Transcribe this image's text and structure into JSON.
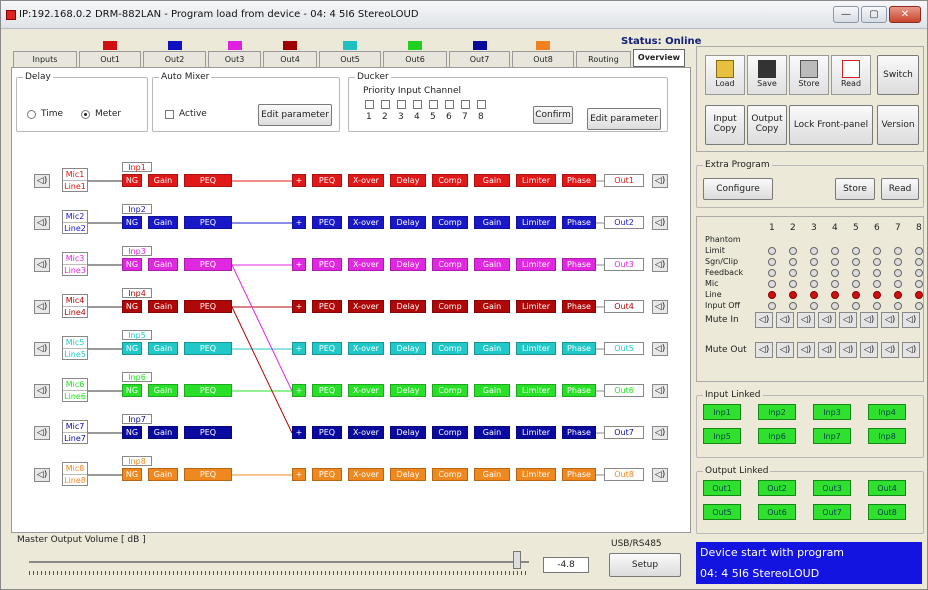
{
  "window": {
    "title": "IP:192.168.0.2  DRM-882LAN - Program load from device - 04: 4 5I6 StereoLOUD",
    "minimize": "—",
    "maximize": "▢",
    "close": "✕"
  },
  "status": "Status: Online",
  "tabs": [
    {
      "label": "Inputs",
      "color": ""
    },
    {
      "label": "Out1",
      "color": "#d01010"
    },
    {
      "label": "Out2",
      "color": "#1010c0"
    },
    {
      "label": "Out3",
      "color": "#e020e0"
    },
    {
      "label": "Out4",
      "color": "#a00000"
    },
    {
      "label": "Out5",
      "color": "#20c0c0"
    },
    {
      "label": "Out6",
      "color": "#20d020"
    },
    {
      "label": "Out7",
      "color": "#0a0a9a"
    },
    {
      "label": "Out8",
      "color": "#f08020"
    },
    {
      "label": "Routing",
      "color": ""
    },
    {
      "label": "Overview",
      "color": ""
    }
  ],
  "delay": {
    "legend": "Delay",
    "opt_time": "Time",
    "opt_meter": "Meter"
  },
  "automixer": {
    "legend": "Auto Mixer",
    "active": "Active",
    "edit": "Edit parameter"
  },
  "ducker": {
    "legend": "Ducker",
    "priority": "Priority Input Channel",
    "nums": [
      "1",
      "2",
      "3",
      "4",
      "5",
      "6",
      "7",
      "8"
    ],
    "confirm": "Confirm",
    "edit": "Edit parameter"
  },
  "blocks": {
    "ng": "NG",
    "gain": "Gain",
    "peq": "PEQ",
    "plus": "+",
    "xover": "X-over",
    "delay": "Delay",
    "comp": "Comp",
    "limiter": "Limiter",
    "phase": "Phase"
  },
  "channels": [
    {
      "mic": "Mic1",
      "line": "Line1",
      "inp": "Inp1",
      "out": "Out1",
      "color": "#e01818"
    },
    {
      "mic": "Mic2",
      "line": "Line2",
      "inp": "Inp2",
      "out": "Out2",
      "color": "#1818c8"
    },
    {
      "mic": "Mic3",
      "line": "Line3",
      "inp": "Inp3",
      "out": "Out3",
      "color": "#e028e0"
    },
    {
      "mic": "Mic4",
      "line": "Line4",
      "inp": "Inp4",
      "out": "Out4",
      "color": "#b00808"
    },
    {
      "mic": "Mic5",
      "line": "Line5",
      "inp": "Inp5",
      "out": "Out5",
      "color": "#20c8c8"
    },
    {
      "mic": "Mic6",
      "line": "Line6",
      "inp": "Inp6",
      "out": "Out6",
      "color": "#28e028"
    },
    {
      "mic": "Mic7",
      "line": "Line7",
      "inp": "Inp7",
      "out": "Out7",
      "color": "#0a0aa0"
    },
    {
      "mic": "Mic8",
      "line": "Line8",
      "inp": "Inp8",
      "out": "Out8",
      "color": "#f08820"
    }
  ],
  "master": {
    "label": "Master Output Volume [ dB ]",
    "value": "-4.8"
  },
  "usb": {
    "label": "USB/RS485",
    "setup": "Setup"
  },
  "toolbar": {
    "load": "Load",
    "save": "Save",
    "store": "Store",
    "read": "Read",
    "switch": "Switch",
    "input_copy": "Input Copy",
    "output_copy": "Output Copy",
    "lock": "Lock Front-panel",
    "version": "Version"
  },
  "extra": {
    "legend": "Extra Program",
    "configure": "Configure",
    "store": "Store",
    "read": "Read"
  },
  "matrix": {
    "cols": [
      "1",
      "2",
      "3",
      "4",
      "5",
      "6",
      "7",
      "8"
    ],
    "rows": [
      "Phantom",
      "Limit",
      "Sgn/Clip",
      "Feedback",
      "Mic",
      "Line",
      "Input Off"
    ],
    "mute_in": "Mute In",
    "mute_out": "Mute Out"
  },
  "input_linked": {
    "legend": "Input Linked",
    "items": [
      "Inp1",
      "Inp2",
      "Inp3",
      "Inp4",
      "Inp5",
      "Inp6",
      "Inp7",
      "Inp8"
    ]
  },
  "output_linked": {
    "legend": "Output Linked",
    "items": [
      "Out1",
      "Out2",
      "Out3",
      "Out4",
      "Out5",
      "Out6",
      "Out7",
      "Out8"
    ]
  },
  "device": {
    "line1": "Device start with program",
    "line2": "04: 4 5I6 StereoLOUD"
  }
}
